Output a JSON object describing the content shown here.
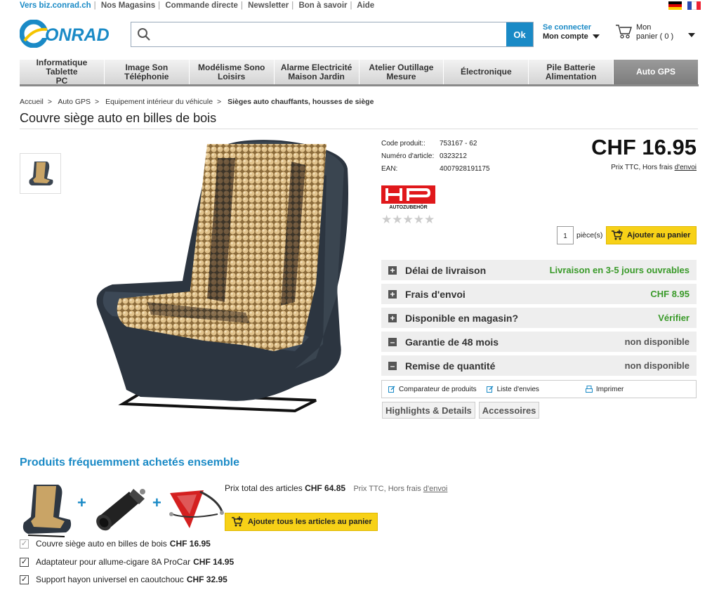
{
  "topbar": {
    "links": [
      "Vers biz.conrad.ch",
      "Nos Magasins",
      "Commande directe",
      "Newsletter",
      "Bon à savoir",
      "Aide"
    ]
  },
  "brand": {
    "logo_text": "CONRAD",
    "accent": "#1a8ac6"
  },
  "search": {
    "placeholder": "",
    "value": "",
    "button_label": "Ok"
  },
  "account": {
    "line1": "Se connecter",
    "line2": "Mon compte"
  },
  "cart": {
    "line1": "Mon",
    "line2": "panier ( 0 )"
  },
  "nav": {
    "items": [
      {
        "line1": "Informatique Tablette",
        "line2": "PC"
      },
      {
        "line1": "Image Son",
        "line2": "Téléphonie"
      },
      {
        "line1": "Modélisme Sono",
        "line2": "Loisirs"
      },
      {
        "line1": "Alarme Electricité",
        "line2": "Maison Jardin"
      },
      {
        "line1": "Atelier Outillage",
        "line2": "Mesure"
      },
      {
        "line1": "Électronique",
        "line2": ""
      },
      {
        "line1": "Pile Batterie",
        "line2": "Alimentation"
      },
      {
        "line1": "Auto GPS",
        "line2": ""
      }
    ]
  },
  "breadcrumb": {
    "items": [
      "Accueil",
      "Auto GPS",
      "Equipement intérieur du véhicule",
      "Sièges auto chauffants, housses de siège"
    ]
  },
  "product": {
    "title": "Couvre siège auto en billes de bois",
    "code_label": "Code produit::",
    "code_value": "753167 - 62",
    "article_label": "Numéro d'article:",
    "article_value": "0323212",
    "ean_label": "EAN:",
    "ean_value": "4007928191175",
    "price": "CHF 16.95",
    "price_note": "Prix TTC, Hors frais",
    "price_note_link": "d'envoi",
    "brand_text": "AUTOZUBEHÖR",
    "rating": 0,
    "quantity": "1",
    "quantity_label": "pièce(s)",
    "add_to_cart": "Ajouter au panier"
  },
  "info": [
    {
      "icon": "plus",
      "label": "Délai de livraison",
      "value": "Livraison en 3-5 jours ouvrables",
      "status": "green"
    },
    {
      "icon": "plus",
      "label": "Frais d'envoi",
      "value": "CHF 8.95",
      "status": "green"
    },
    {
      "icon": "plus",
      "label": "Disponible en magasin?",
      "value": "Vérifier",
      "status": "green"
    },
    {
      "icon": "minus",
      "label": "Garantie de 48 mois",
      "value": "non disponible",
      "status": "grey"
    },
    {
      "icon": "minus",
      "label": "Remise de quantité",
      "value": "non disponible",
      "status": "grey"
    }
  ],
  "tools": {
    "compare": "Comparateur de produits",
    "wishlist": "Liste d'envies",
    "print": "Imprimer"
  },
  "tabs": [
    "Highlights & Details",
    "Accessoires"
  ],
  "fbt": {
    "title": "Produits fréquemment achetés ensemble",
    "total_label": "Prix total des articles",
    "total_value": "CHF 64.85",
    "total_note": "Prix TTC, Hors frais",
    "total_note_link": "d'envoi",
    "add_all": "Ajouter tous les articles au panier",
    "items": [
      {
        "name": "Couvre siège auto en billes de bois",
        "price": "CHF 16.95",
        "checked": true,
        "disabled": true
      },
      {
        "name": "Adaptateur pour allume-cigare 8A ProCar",
        "price": "CHF 14.95",
        "checked": true,
        "disabled": false
      },
      {
        "name": "Support hayon universel en caoutchouc",
        "price": "CHF 32.95",
        "checked": true,
        "disabled": false
      }
    ]
  }
}
